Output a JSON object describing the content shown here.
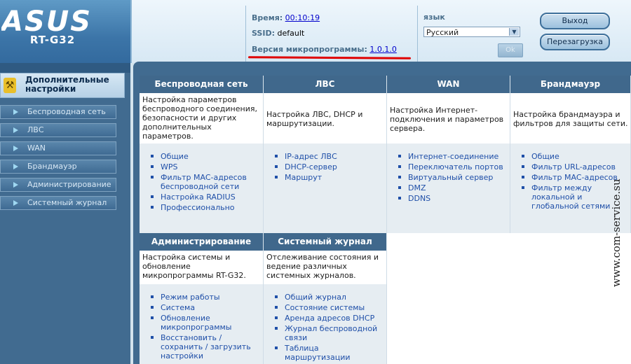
{
  "brand": {
    "logo_text": "ASUS",
    "model": "RT-G32"
  },
  "status": {
    "time_label": "Время:",
    "time_value": "00:10:19",
    "ssid_label": "SSID:",
    "ssid_value": "default",
    "fw_label": "Версия микропрограммы:",
    "fw_value": "1.0.1.0"
  },
  "lang": {
    "label": "язык",
    "selected": "Русский",
    "apply_label": "Ok"
  },
  "buttons": {
    "logout": "Выход",
    "reboot": "Перезагрузка"
  },
  "sidebar": {
    "header": "Дополнительные настройки",
    "items": [
      {
        "label": "Беспроводная сеть"
      },
      {
        "label": "ЛВС"
      },
      {
        "label": "WAN"
      },
      {
        "label": "Брандмауэр"
      },
      {
        "label": "Администрирование"
      },
      {
        "label": "Системный журнал"
      }
    ]
  },
  "cards": [
    {
      "title": "Беспроводная сеть",
      "desc": "Настройка параметров беспроводного соединения, безопасности и других дополнительных параметров.",
      "links": [
        "Общие",
        "WPS",
        "Фильтр MAC-адресов беспроводной сети",
        "Настройка RADIUS",
        "Профессионально"
      ]
    },
    {
      "title": "ЛВС",
      "desc": "Настройка ЛВС, DHCP и маршрутизации.",
      "links": [
        "IP-адрес ЛВС",
        "DHCP-сервер",
        "Маршрут"
      ]
    },
    {
      "title": "WAN",
      "desc": "Настройка Интернет-подключения и параметров сервера.",
      "links": [
        "Интернет-соединение",
        "Переключатель портов",
        "Виртуальный сервер",
        "DMZ",
        "DDNS"
      ]
    },
    {
      "title": "Брандмауэр",
      "desc": "Настройка брандмауэра и фильтров для защиты сети.",
      "links": [
        "Общие",
        "Фильтр URL-адресов",
        "Фильтр MAC-адресов",
        "Фильтр между локальной и глобальной сетями"
      ]
    },
    {
      "title": "Администрирование",
      "desc": "Настройка системы и обновление микропрограммы RT-G32.",
      "links": [
        "Режим работы",
        "Система",
        "Обновление микропрограммы",
        "Восстановить / сохранить / загрузить настройки"
      ]
    },
    {
      "title": "Системный журнал",
      "desc": "Отслеживание состояния и ведение различных системных журналов.",
      "links": [
        "Общий журнал",
        "Состояние системы",
        "Аренда адресов DHCP",
        "Журнал беспроводной связи",
        "Таблица маршрутизации"
      ]
    }
  ],
  "watermark": "www.com-service.su"
}
